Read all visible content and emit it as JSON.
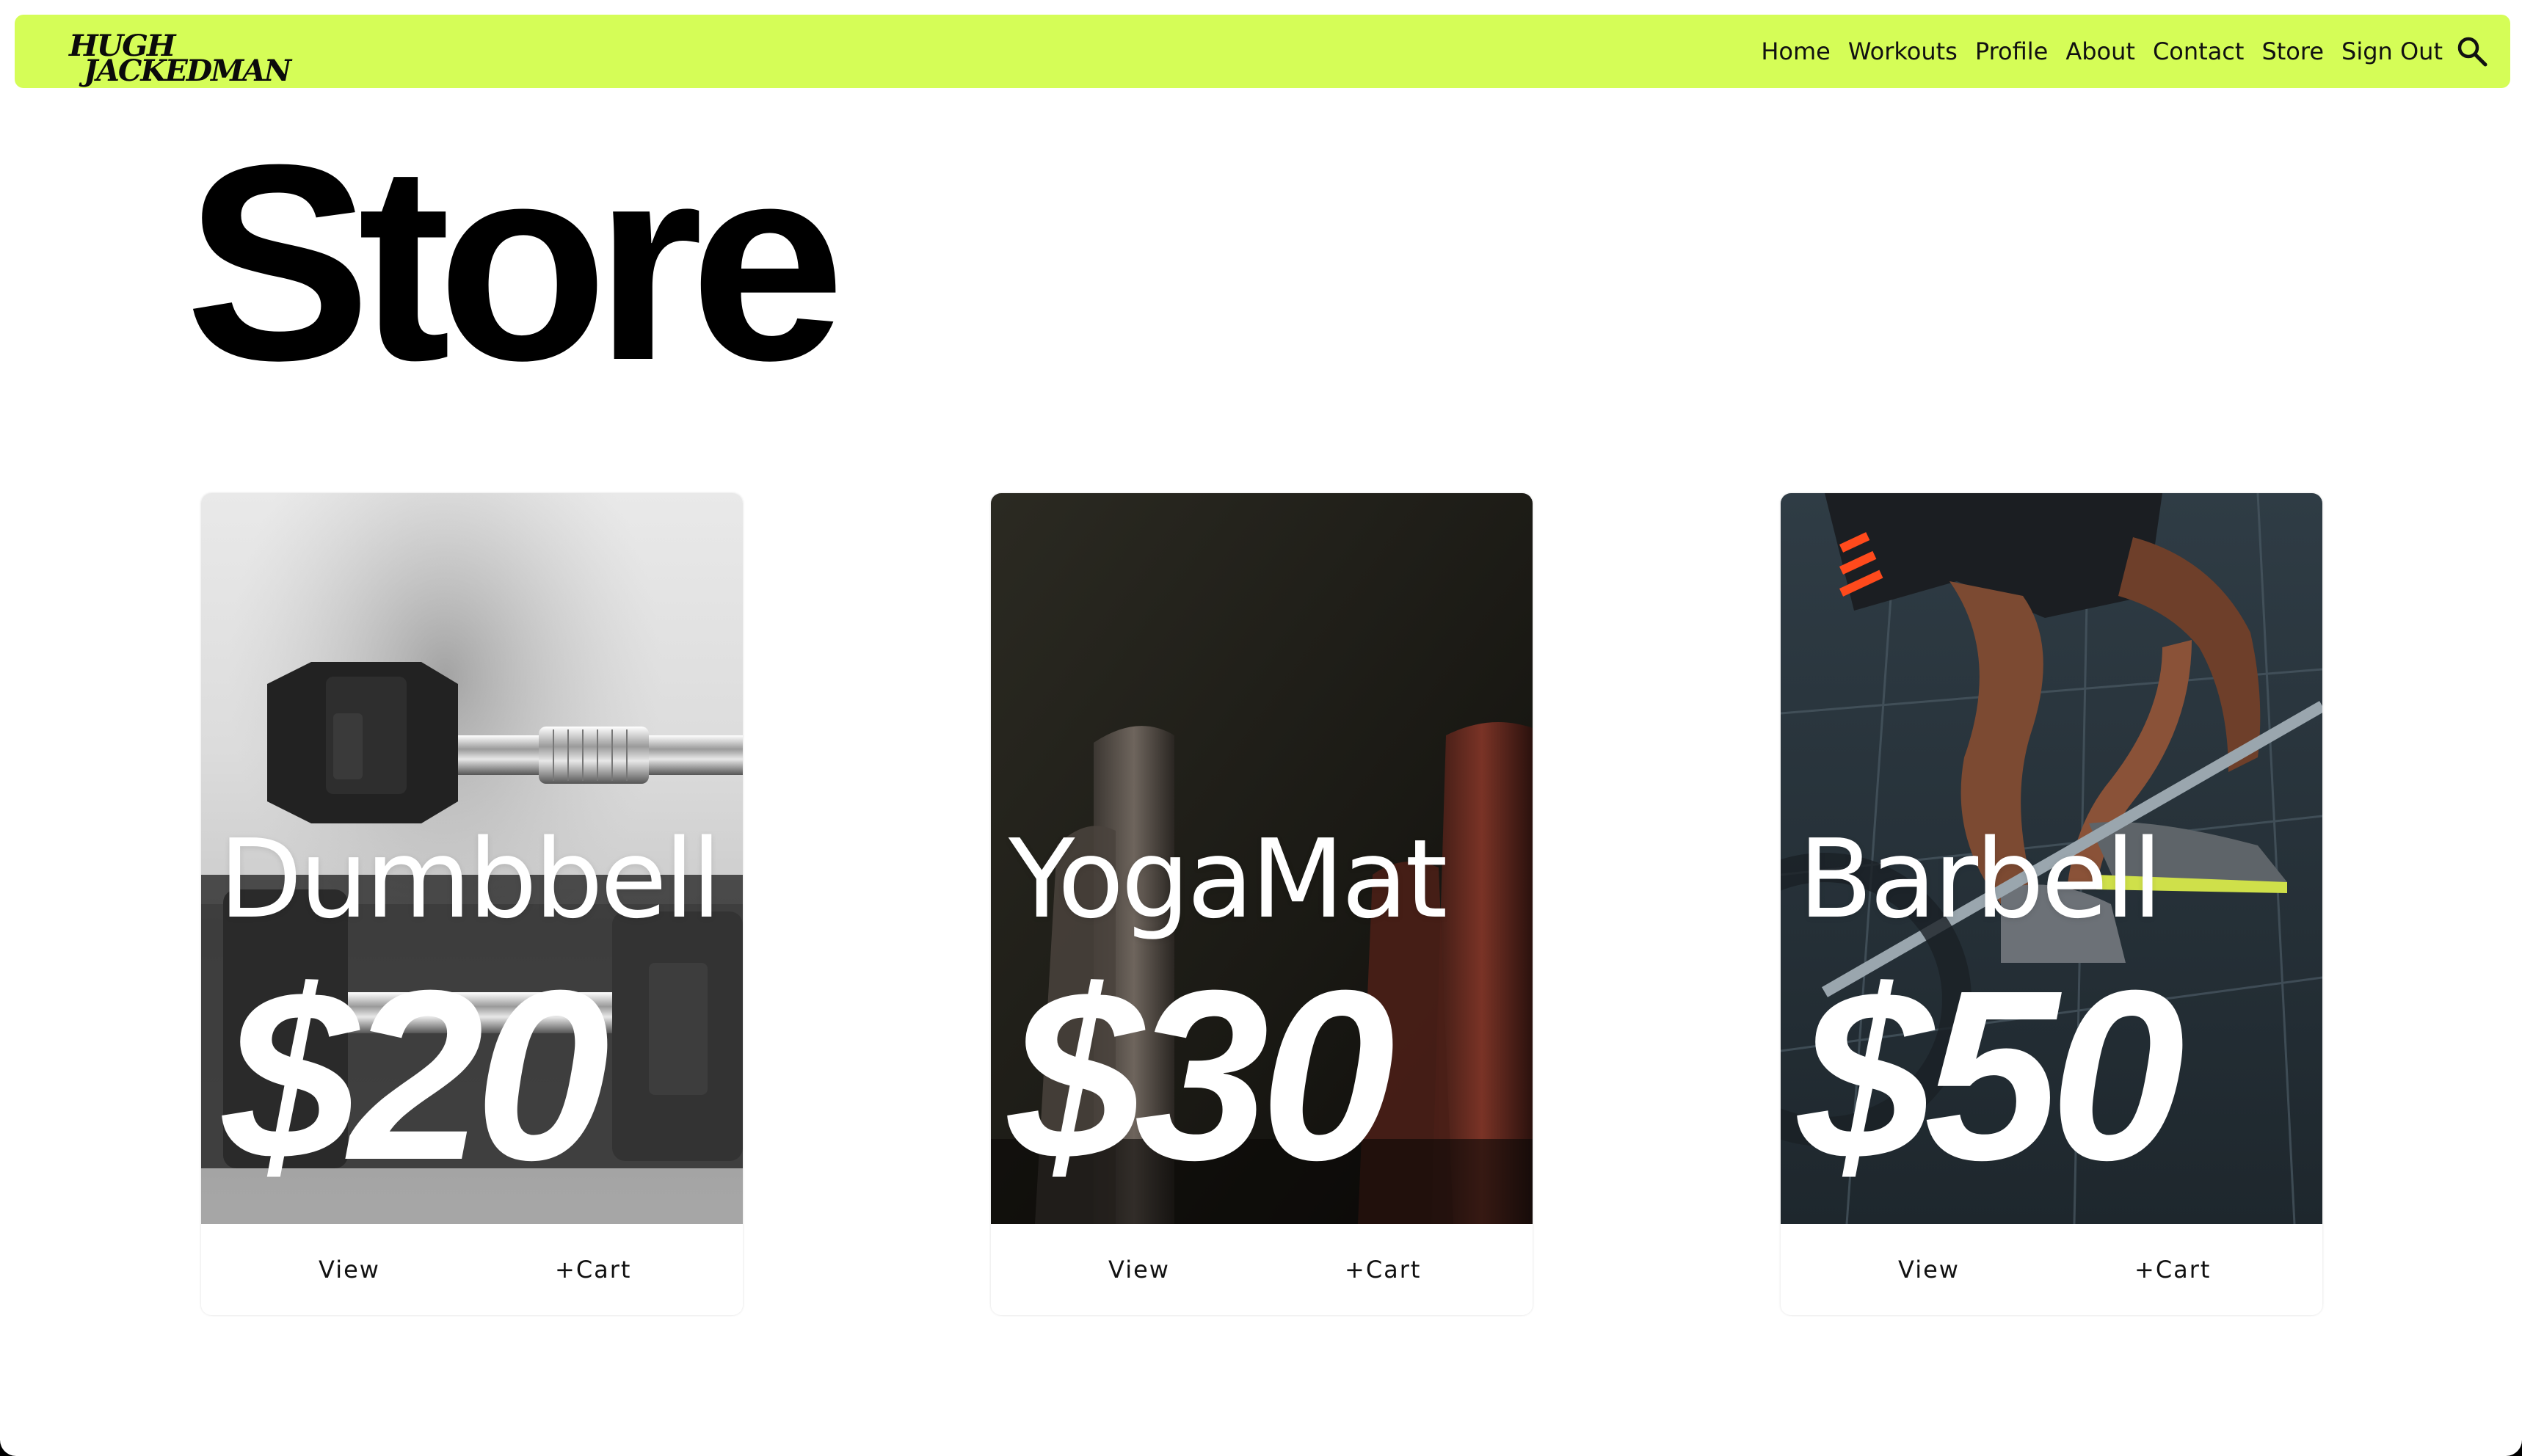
{
  "brand": {
    "logo_line1": "HUGH",
    "logo_line2": "JACKEDMAN",
    "accent_color": "#d5fd57"
  },
  "nav": {
    "items": [
      {
        "label": "Home"
      },
      {
        "label": "Workouts"
      },
      {
        "label": "Profile"
      },
      {
        "label": "About"
      },
      {
        "label": "Contact"
      },
      {
        "label": "Store"
      },
      {
        "label": "Sign Out"
      }
    ],
    "search_icon": "search-icon"
  },
  "page": {
    "title": "Store"
  },
  "products": [
    {
      "name": "Dumbbell",
      "price": "$20",
      "view_label": "View",
      "cart_label": "+Cart"
    },
    {
      "name": "YogaMat",
      "price": "$30",
      "view_label": "View",
      "cart_label": "+Cart"
    },
    {
      "name": "Barbell",
      "price": "$50",
      "view_label": "View",
      "cart_label": "+Cart"
    }
  ]
}
